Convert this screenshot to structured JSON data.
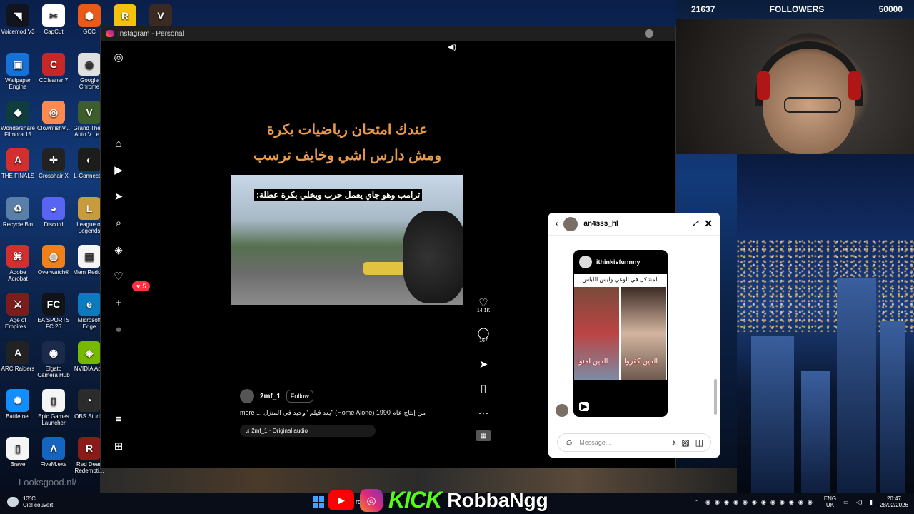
{
  "desktop": {
    "icons": [
      {
        "label": "Voicemod V3",
        "icon": "voicemod-icon",
        "color": "#11141c",
        "glyph": "◥"
      },
      {
        "label": "CapCut",
        "icon": "capcut-icon",
        "color": "#ffffff",
        "glyph": "✂"
      },
      {
        "label": "GCC",
        "icon": "gcc-icon",
        "color": "#e8591a",
        "glyph": "⬢"
      },
      {
        "label": "",
        "icon": "rockstar-icon",
        "color": "#f4c20d",
        "glyph": "R"
      },
      {
        "label": "",
        "icon": "valorant-icon",
        "color": "#3a2a22",
        "glyph": "V"
      },
      {
        "label": "Wallpaper Engine",
        "icon": "wallpaper-engine-icon",
        "color": "#1672d6",
        "glyph": "▣"
      },
      {
        "label": "CCleaner 7",
        "icon": "ccleaner-icon",
        "color": "#c62828",
        "glyph": "C"
      },
      {
        "label": "Google Chrome",
        "icon": "chrome-icon",
        "color": "#e0e0e0",
        "glyph": "◉"
      },
      {
        "label": "Wondershare Filmora 15",
        "icon": "filmora-icon",
        "color": "#0f3d3e",
        "glyph": "◆"
      },
      {
        "label": "ClownfishV...",
        "icon": "clownfish-icon",
        "color": "#ff8a50",
        "glyph": "◎"
      },
      {
        "label": "Grand The... Auto V Le...",
        "icon": "gta-icon",
        "color": "#3d5e2a",
        "glyph": "V"
      },
      {
        "label": "THE FINALS",
        "icon": "the-finals-icon",
        "color": "#d32f2f",
        "glyph": "A"
      },
      {
        "label": "Crosshair X",
        "icon": "crosshair-icon",
        "color": "#222222",
        "glyph": "✛"
      },
      {
        "label": "L-Connect...",
        "icon": "lconnect-icon",
        "color": "#1c1c1c",
        "glyph": "◐"
      },
      {
        "label": "Recycle Bin",
        "icon": "recycle-bin-icon",
        "color": "#5a7fa8",
        "glyph": "♻"
      },
      {
        "label": "Discord",
        "icon": "discord-icon",
        "color": "#5865f2",
        "glyph": "◕"
      },
      {
        "label": "League of Legends",
        "icon": "league-icon",
        "color": "#c89b3c",
        "glyph": "L"
      },
      {
        "label": "Adobe Acrobat",
        "icon": "acrobat-icon",
        "color": "#d32f2f",
        "glyph": "⌘"
      },
      {
        "label": "Overwatch®",
        "icon": "overwatch-icon",
        "color": "#f0801a",
        "glyph": "◍"
      },
      {
        "label": "Mem Reduct",
        "icon": "mem-reduct-icon",
        "color": "#f5f5f5",
        "glyph": "▤"
      },
      {
        "label": "Age of Empires...",
        "icon": "aoe-icon",
        "color": "#7a1d1d",
        "glyph": "⚔"
      },
      {
        "label": "EA SPORTS FC 26",
        "icon": "fc26-icon",
        "color": "#101418",
        "glyph": "FC"
      },
      {
        "label": "Microsoft Edge",
        "icon": "edge-icon",
        "color": "#0c7abf",
        "glyph": "e"
      },
      {
        "label": "ARC Raiders",
        "icon": "arc-raiders-icon",
        "color": "#222222",
        "glyph": "A"
      },
      {
        "label": "Elgato Camera Hub",
        "icon": "elgato-icon",
        "color": "#1b2a4a",
        "glyph": "◉"
      },
      {
        "label": "NVIDIA App",
        "icon": "nvidia-icon",
        "color": "#76b900",
        "glyph": "◈"
      },
      {
        "label": "Battle.net",
        "icon": "battlenet-icon",
        "color": "#148eff",
        "glyph": "✺"
      },
      {
        "label": "Epic Games Launcher",
        "icon": "epic-icon",
        "color": "#f5f5f5",
        "glyph": "▯"
      },
      {
        "label": "OBS Studio",
        "icon": "obs-icon",
        "color": "#2b2b2b",
        "glyph": "◔"
      },
      {
        "label": "Brave",
        "icon": "brave-icon",
        "color": "#f5f5f5",
        "glyph": "▯"
      },
      {
        "label": "FiveM.exe",
        "icon": "fivem-icon",
        "color": "#1565c0",
        "glyph": "Λ"
      },
      {
        "label": "Red Dead Redempti...",
        "icon": "rdr-icon",
        "color": "#8b1a1a",
        "glyph": "R"
      }
    ],
    "watermark": "Looksgood.nl/"
  },
  "window": {
    "title": "Instagram - Personal",
    "menu_glyph": "···"
  },
  "sidebar": {
    "notif_count": "5"
  },
  "reel": {
    "headline_line1": "عندك امتحان رياضيات بكرة",
    "headline_line2": "ومش دارس اشي وخايف ترسب",
    "video_caption": "ترامب وهو جاي يعمل حرب ويخلي بكرة عطلة:",
    "author": "2mf_1",
    "follow_label": "Follow",
    "description": "more ... يعد فيلم \"وحيد في المنزل\" (Home Alone) من إنتاج عام 1990",
    "audio": "2mf_1 · Original audio",
    "likes": "14.1K",
    "comments": "167"
  },
  "chat": {
    "username": "an4sss_hl",
    "shared_author": "ithinkisfunnny",
    "shared_title": "المشكل في الوعي وليس اللباس",
    "label_left": "الدين امنوا",
    "label_right": "الدين كفروا",
    "message_placeholder": "Message..."
  },
  "stream": {
    "followers_count": "21637",
    "followers_label": "FOLLOWERS",
    "followers_goal": "50000",
    "handle": "RobbaNgg",
    "kick": "KICK"
  },
  "taskbar": {
    "temperature": "13°C",
    "weather": "Ciel couvert",
    "search_fragment": "rch",
    "lang_top": "ENG",
    "lang_bottom": "UK",
    "time": "20:47",
    "date": "28/02/2026"
  },
  "colors": {
    "instagram_gradient": [
      "#f58529",
      "#dd2a7b",
      "#8134af"
    ],
    "kick_green": "#53fc18",
    "youtube_red": "#ff0000",
    "headline_orange": "#e89a4a",
    "notif_red": "#ff3040"
  }
}
